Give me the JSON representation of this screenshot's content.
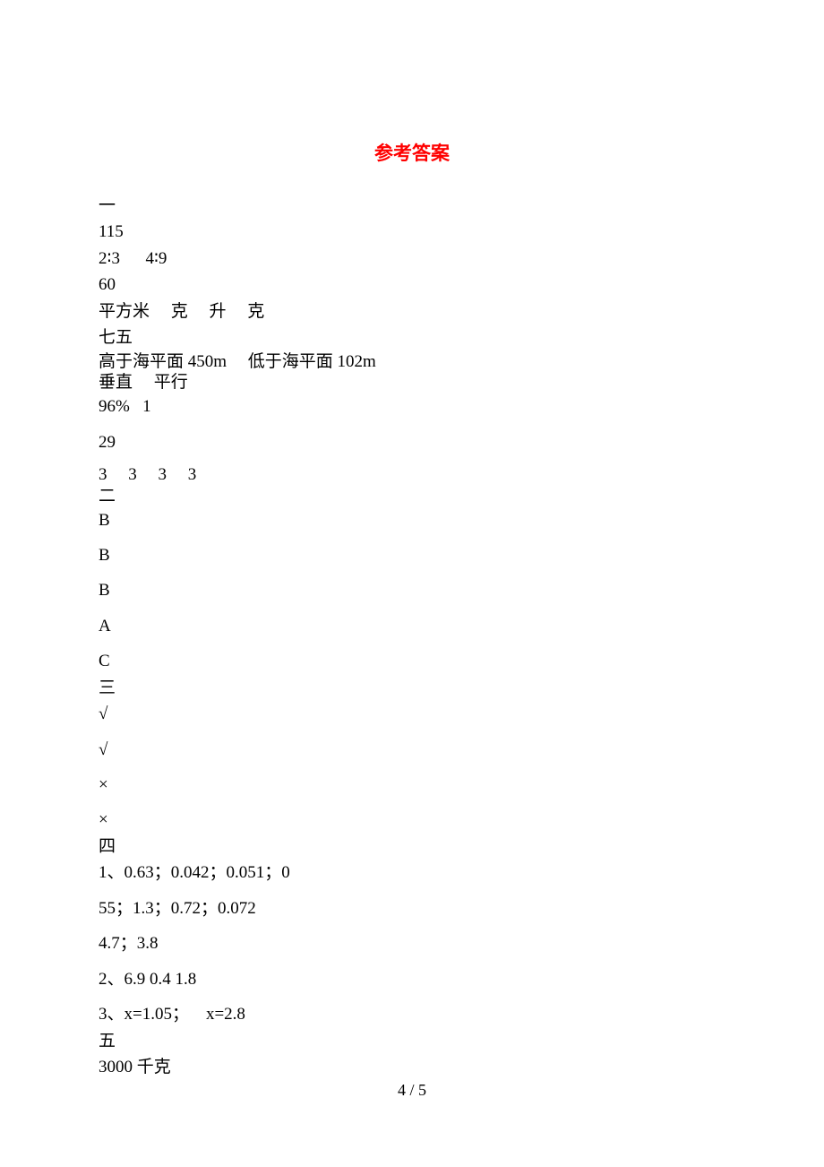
{
  "title": "参考答案",
  "section1": {
    "header": "一",
    "l1": "115",
    "l2": "2∶3      4∶9",
    "l3": "60",
    "l4": "平方米     克     升     克",
    "l5": "七五",
    "l6": "高于海平面 450m     低于海平面 102m",
    "l7": "垂直     平行",
    "l8": "96%   1",
    "l9": "29",
    "l10": "3     3     3     3"
  },
  "section2": {
    "header": "二",
    "a1": "B",
    "a2": "B",
    "a3": "B",
    "a4": "A",
    "a5": "C"
  },
  "section3": {
    "header": "三",
    "a1": "√",
    "a2": "√",
    "a3": "×",
    "a4": "×"
  },
  "section4": {
    "header": "四",
    "l1": "1、0.63；0.042；0.051；0",
    "l2": "55；1.3；0.72；0.072",
    "l3": "4.7；3.8",
    "l4": "2、6.9 0.4 1.8",
    "l5": "3、x=1.05；    x=2.8"
  },
  "section5": {
    "header": "五",
    "l1": "3000 千克"
  },
  "pageNumber": "4 / 5"
}
